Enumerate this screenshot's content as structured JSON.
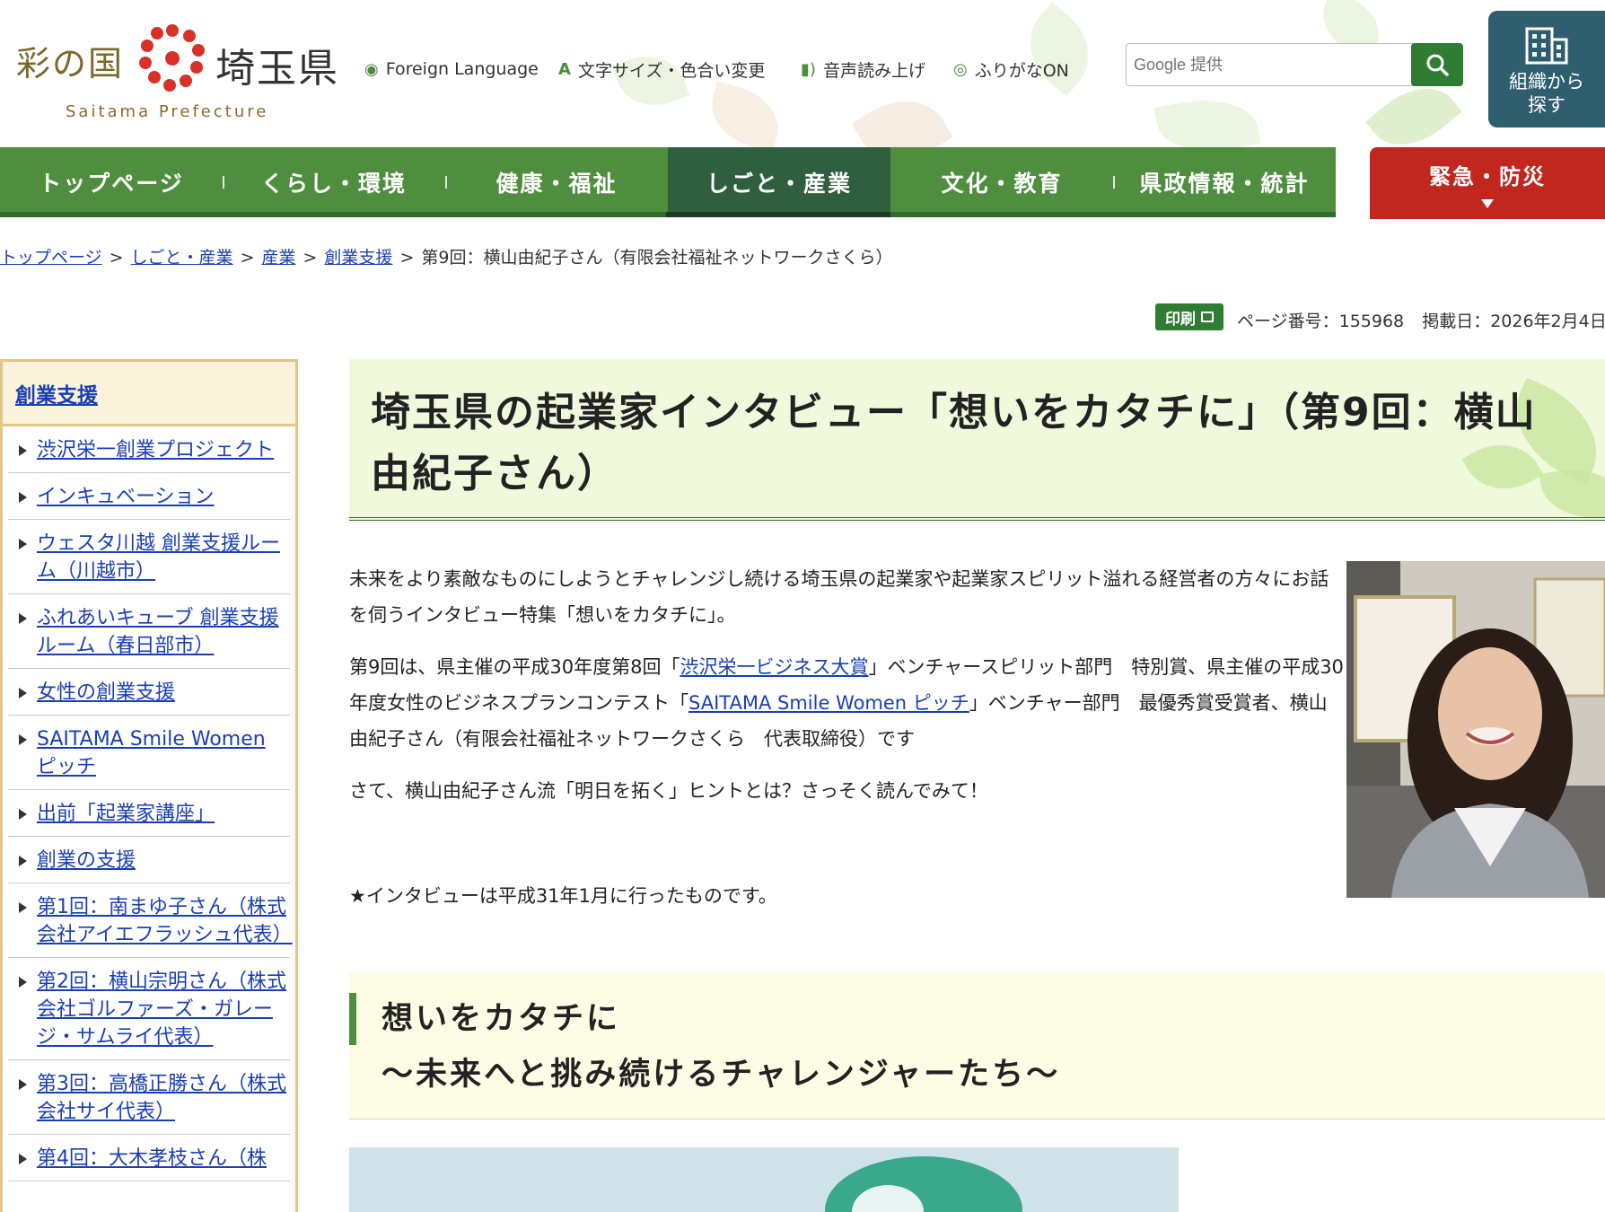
{
  "site": {
    "logo_left": "彩の国",
    "logo_right": "埼玉県",
    "logo_en": "Saitama Prefecture"
  },
  "utility": {
    "foreign_language": "Foreign Language",
    "text_size": "文字サイズ・色合い変更",
    "read_aloud": "音声読み上げ",
    "furigana": "ふりがなON"
  },
  "search": {
    "placeholder": "Google 提供"
  },
  "org_button": {
    "line1": "組織から",
    "line2": "探す"
  },
  "nav": {
    "items": [
      {
        "label": "トップページ"
      },
      {
        "label": "くらし・環境"
      },
      {
        "label": "健康・福祉"
      },
      {
        "label": "しごと・産業"
      },
      {
        "label": "文化・教育"
      },
      {
        "label": "県政情報・統計"
      }
    ],
    "active_index": 3,
    "emergency": "緊急・防災"
  },
  "breadcrumb": {
    "items": [
      "トップページ",
      "しごと・産業",
      "産業",
      "創業支援"
    ],
    "current": "第9回：横山由紀子さん（有限会社福祉ネットワークさくら）",
    "separator": ">"
  },
  "meta": {
    "print": "印刷",
    "page_number": "ページ番号：155968",
    "date": "掲載日：2026年2月4日"
  },
  "sidebar": {
    "heading": "創業支援",
    "items": [
      {
        "label": "渋沢栄一創業プロジェクト"
      },
      {
        "label": "インキュベーション"
      },
      {
        "label": "ウェスタ川越 創業支援ルーム（川越市）"
      },
      {
        "label": "ふれあいキューブ 創業支援ルーム（春日部市）"
      },
      {
        "label": "女性の創業支援"
      },
      {
        "label": "SAITAMA Smile Women ピッチ"
      },
      {
        "label": "出前「起業家講座」"
      },
      {
        "label": "創業の支援"
      },
      {
        "label": "第1回：南まゆ子さん（株式会社アイエフラッシュ代表）"
      },
      {
        "label": "第2回：横山宗明さん（株式会社ゴルファーズ・ガレージ・サムライ代表）"
      },
      {
        "label": "第3回：高橋正勝さん（株式会社サイ代表）"
      },
      {
        "label": "第4回：大木孝枝さん（株"
      }
    ]
  },
  "main": {
    "title": "埼玉県の起業家インタビュー「想いをカタチに」（第9回：横山由紀子さん）",
    "para1": "未来をより素敵なものにしようとチャレンジし続ける埼玉県の起業家や起業家スピリット溢れる経営者の方々にお話を伺うインタビュー特集「想いをカタチに」。",
    "para2_a": "第9回は、県主催の平成30年度第8回「",
    "para2_link1": "渋沢栄一ビジネス大賞",
    "para2_b": "」ベンチャースピリット部門　特別賞、県主催の平成30年度女性のビジネスプランコンテスト「",
    "para2_link2": "SAITAMA Smile Women ピッチ",
    "para2_c": "」ベンチャー部門　最優秀賞受賞者、横山由紀子さん（有限会社福祉ネットワークさくら　代表取締役）です",
    "para3": "さて、横山由紀子さん流「明日を拓く」ヒントとは？さっそく読んでみて！",
    "note": "★インタビューは平成31年1月に行ったものです。",
    "sub_line1": "想いをカタチに",
    "sub_line2": "～未来へと挑み続けるチャレンジャーたち～"
  }
}
